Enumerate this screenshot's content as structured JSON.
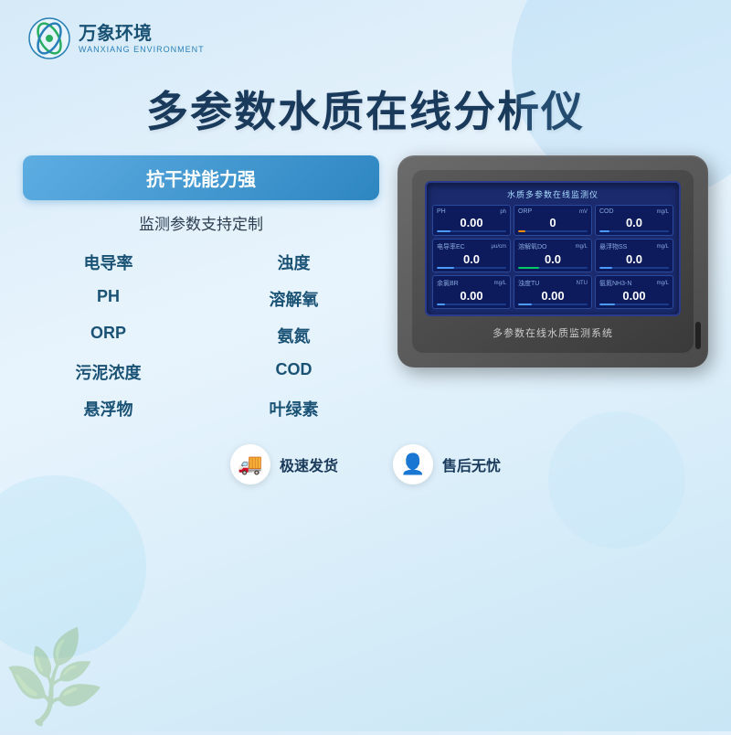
{
  "brand": {
    "logo_cn": "万象环境",
    "logo_en": "WANXIANG ENVIRONMENT"
  },
  "main_title": "多参数水质在线分析仪",
  "left": {
    "badge": "抗干扰能力强",
    "subtitle": "监测参数支持定制",
    "params": [
      {
        "label": "电导率"
      },
      {
        "label": "浊度"
      },
      {
        "label": "PH"
      },
      {
        "label": "溶解氧"
      },
      {
        "label": "ORP"
      },
      {
        "label": "氨氮"
      },
      {
        "label": "污泥浓度"
      },
      {
        "label": "COD"
      },
      {
        "label": "悬浮物"
      },
      {
        "label": "叶绿素"
      }
    ]
  },
  "device": {
    "screen_title": "水质多参数在线监测仪",
    "cells": [
      {
        "label": "PH",
        "unit": "ph",
        "value": "0.00",
        "bar": 20,
        "color": "blue"
      },
      {
        "label": "ORP",
        "unit": "mV",
        "value": "0",
        "bar": 10,
        "color": "orange"
      },
      {
        "label": "COD",
        "unit": "mg/L",
        "value": "0.0",
        "bar": 15,
        "color": "blue"
      },
      {
        "label": "电导率EC",
        "unit": "μu/cm",
        "value": "0.0",
        "bar": 25,
        "color": "blue"
      },
      {
        "label": "溶解氧DO",
        "unit": "mg/L",
        "value": "0.0",
        "bar": 30,
        "color": "green"
      },
      {
        "label": "悬浮物SS",
        "unit": "mg/L",
        "value": "0.0",
        "bar": 18,
        "color": "blue"
      },
      {
        "label": "余氯BR",
        "unit": "mg/L",
        "value": "0.00",
        "bar": 12,
        "color": "blue"
      },
      {
        "label": "浊度TU",
        "unit": "NTU",
        "value": "0.00",
        "bar": 20,
        "color": "blue"
      },
      {
        "label": "氨氮NH3-N",
        "unit": "mg/L",
        "value": "0.00",
        "bar": 22,
        "color": "blue"
      }
    ],
    "bottom_label": "多参数在线水质监测系统"
  },
  "bottom": {
    "features": [
      {
        "icon": "🚚",
        "text": "极速发货"
      },
      {
        "icon": "👤",
        "text": "售后无忧"
      }
    ]
  }
}
